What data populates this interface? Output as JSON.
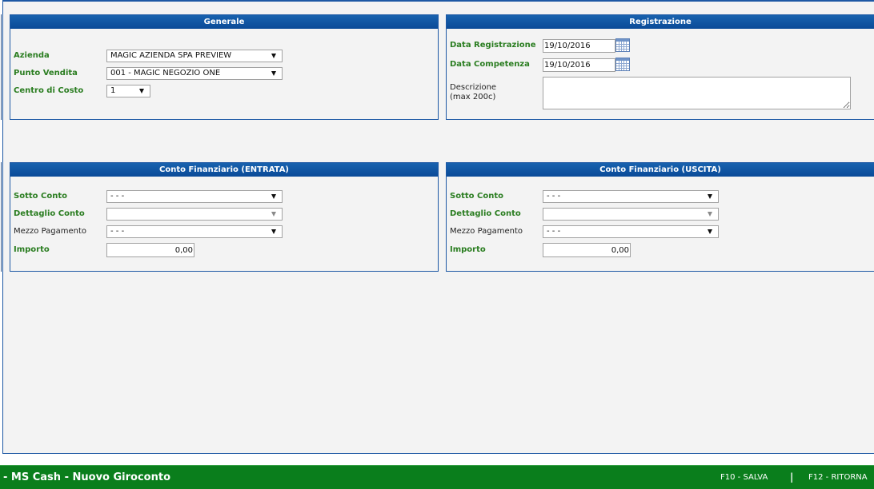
{
  "colors": {
    "frame_border": "#1d58a4",
    "header_top": "#1862ae",
    "header_bottom": "#0a4a98",
    "label_green": "#2a7d20",
    "footer_green": "#0a7e1c",
    "page_background": "#f3f3f3"
  },
  "icons": {
    "calendar": "calendar-icon",
    "dropdown": "dropdown-arrow-icon"
  },
  "panels": {
    "generale": {
      "title": "Generale",
      "azienda": {
        "label": "Azienda",
        "value": "MAGIC AZIENDA SPA PREVIEW"
      },
      "punto_vendita": {
        "label": "Punto Vendita",
        "value": "001 - MAGIC NEGOZIO ONE"
      },
      "centro_di_costo": {
        "label": "Centro di Costo",
        "value": "1"
      }
    },
    "registrazione": {
      "title": "Registrazione",
      "data_registrazione": {
        "label": "Data Registrazione",
        "value": "19/10/2016"
      },
      "data_competenza": {
        "label": "Data Competenza",
        "value": "19/10/2016"
      },
      "descrizione": {
        "label": "Descrizione",
        "hint": "(max 200c)",
        "value": ""
      }
    },
    "entrata": {
      "title": "Conto Finanziario (ENTRATA)",
      "sotto_conto": {
        "label": "Sotto Conto",
        "value": "- - -"
      },
      "dettaglio_conto": {
        "label": "Dettaglio Conto",
        "value": "",
        "disabled": true
      },
      "mezzo_pagamento": {
        "label": "Mezzo Pagamento",
        "value": "- - -"
      },
      "importo": {
        "label": "Importo",
        "value": "0,00"
      }
    },
    "uscita": {
      "title": "Conto Finanziario (USCITA)",
      "sotto_conto": {
        "label": "Sotto Conto",
        "value": "- - -"
      },
      "dettaglio_conto": {
        "label": "Dettaglio Conto",
        "value": "",
        "disabled": true
      },
      "mezzo_pagamento": {
        "label": "Mezzo Pagamento",
        "value": "- - -"
      },
      "importo": {
        "label": "Importo",
        "value": "0,00"
      }
    }
  },
  "footer": {
    "title": "- MS Cash - Nuovo Giroconto",
    "actions": [
      {
        "label": "F10 - SALVA"
      },
      {
        "label": "F12 - RITORNA"
      }
    ],
    "separator": "|"
  }
}
